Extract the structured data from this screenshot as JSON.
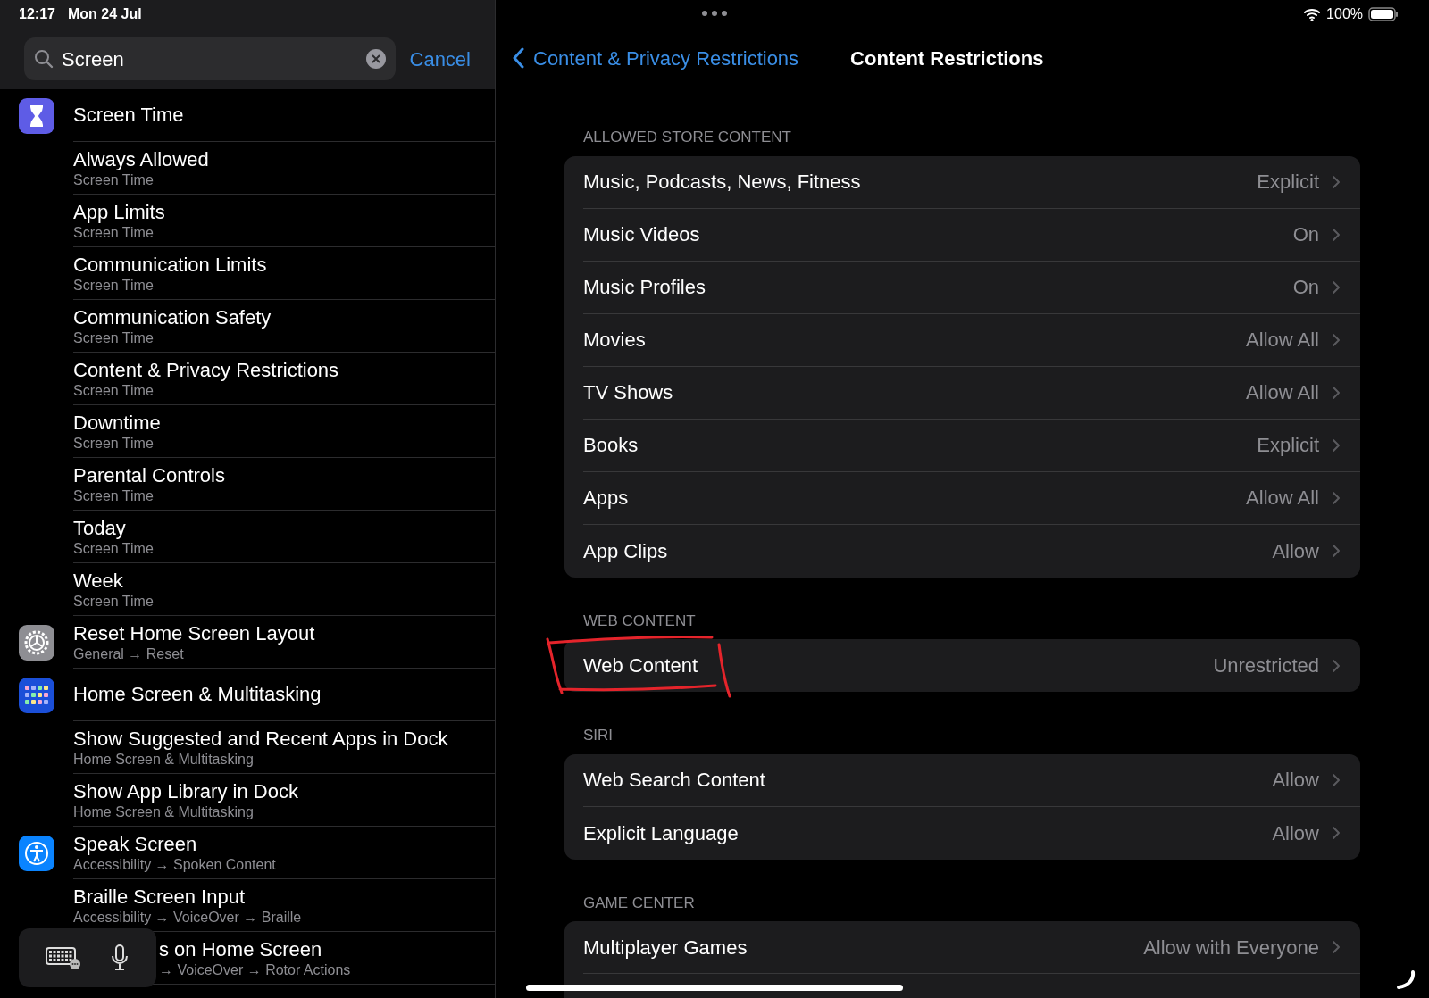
{
  "status_bar": {
    "time": "12:17",
    "date": "Mon 24 Jul",
    "battery": "100%"
  },
  "search": {
    "value": "Screen",
    "cancel": "Cancel"
  },
  "results": [
    {
      "title": "Screen Time",
      "kind": "hourglass"
    },
    {
      "title": "Always Allowed",
      "subtitle": "Screen Time"
    },
    {
      "title": "App Limits",
      "subtitle": "Screen Time"
    },
    {
      "title": "Communication Limits",
      "subtitle": "Screen Time"
    },
    {
      "title": "Communication Safety",
      "subtitle": "Screen Time"
    },
    {
      "title": "Content & Privacy Restrictions",
      "subtitle": "Screen Time"
    },
    {
      "title": "Downtime",
      "subtitle": "Screen Time"
    },
    {
      "title": "Parental Controls",
      "subtitle": "Screen Time"
    },
    {
      "title": "Today",
      "subtitle": "Screen Time"
    },
    {
      "title": "Week",
      "subtitle": "Screen Time"
    },
    {
      "title": "Reset Home Screen Layout",
      "subtitle": "General → Reset",
      "kind": "gear"
    },
    {
      "title": "Home Screen & Multitasking",
      "kind": "grid"
    },
    {
      "title": "Show Suggested and Recent Apps in Dock",
      "subtitle": "Home Screen & Multitasking"
    },
    {
      "title": "Show App Library in Dock",
      "subtitle": "Home Screen & Multitasking"
    },
    {
      "title": "Speak Screen",
      "subtitle": "Accessibility → Spoken Content",
      "kind": "accessibility"
    },
    {
      "title": "Braille Screen Input",
      "subtitle": "Accessibility → VoiceOver → Braille"
    },
    {
      "title": "s on Home Screen",
      "subtitle": "→ VoiceOver → Rotor Actions",
      "covered": true
    }
  ],
  "dictation_bar": {
    "buttons": [
      {
        "kind": "keyboard"
      },
      {
        "kind": "microphone"
      }
    ]
  },
  "nav": {
    "back": "Content & Privacy Restrictions",
    "title": "Content Restrictions"
  },
  "sections": [
    {
      "header": "ALLOWED STORE CONTENT",
      "rows": [
        {
          "label": "Music, Podcasts, News, Fitness",
          "value": "Explicit"
        },
        {
          "label": "Music Videos",
          "value": "On"
        },
        {
          "label": "Music Profiles",
          "value": "On"
        },
        {
          "label": "Movies",
          "value": "Allow All"
        },
        {
          "label": "TV Shows",
          "value": "Allow All"
        },
        {
          "label": "Books",
          "value": "Explicit"
        },
        {
          "label": "Apps",
          "value": "Allow All"
        },
        {
          "label": "App Clips",
          "value": "Allow"
        }
      ]
    },
    {
      "header": "WEB CONTENT",
      "rows": [
        {
          "label": "Web Content",
          "value": "Unrestricted",
          "circled": true
        }
      ]
    },
    {
      "header": "SIRI",
      "rows": [
        {
          "label": "Web Search Content",
          "value": "Allow"
        },
        {
          "label": "Explicit Language",
          "value": "Allow"
        }
      ]
    },
    {
      "header": "GAME CENTER",
      "more_below": true,
      "rows": [
        {
          "label": "Multiplayer Games",
          "value": "Allow with Everyone"
        }
      ]
    }
  ]
}
